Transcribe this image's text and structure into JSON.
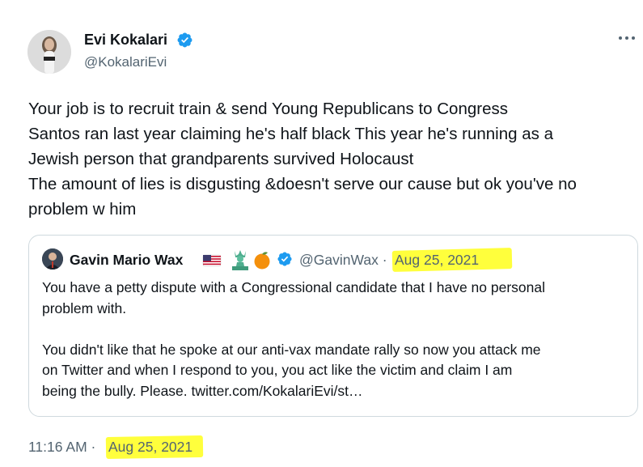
{
  "tweet": {
    "author": {
      "name": "Evi Kokalari",
      "handle": "@KokalariEvi",
      "avatar_icon": "profile-photo",
      "verified_icon": "verified-badge-icon"
    },
    "more_icon": "more-options-icon",
    "text_lines": [
      "Your job is to recruit train & send Young Republicans to Congress",
      "Santos ran last year claiming he's half black This year he's running as a",
      "Jewish person that grandparents survived Holocaust",
      "The amount of lies is disgusting &doesn't serve our cause but ok you've no",
      "problem w him"
    ],
    "time": "11:16 AM",
    "separator": "·",
    "date": "Aug 25, 2021"
  },
  "quoted": {
    "name": "Gavin Mario Wax",
    "emojis": [
      "us-flag-icon",
      "statue-of-liberty-icon",
      "orange-icon"
    ],
    "handle": "@GavinWax",
    "separator": "·",
    "date": "Aug 25, 2021",
    "text_lines_p1": [
      "You have a petty dispute with a Congressional candidate that I have no personal",
      "problem with."
    ],
    "text_lines_p2": [
      "You didn't like that he spoke at our anti-vax mandate rally so now you attack me",
      "on Twitter and when I respond to you, you act like the victim and claim I am",
      "being the bully. Please. twitter.com/KokalariEvi/st…"
    ]
  },
  "colors": {
    "text": "#0f1419",
    "secondary": "#536471",
    "verified": "#1d9bf0",
    "highlight": "#ffff3c",
    "border": "#cfd9de"
  }
}
